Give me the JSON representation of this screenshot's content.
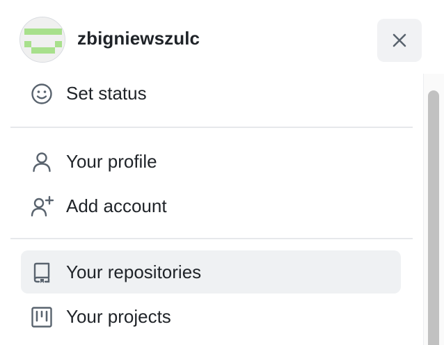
{
  "header": {
    "username": "zbigniewszulc",
    "avatar_icon": "identicon-avatar",
    "avatar_color": "#a8e08c",
    "close_icon": "close-icon"
  },
  "menu": {
    "items": [
      {
        "label": "Set status",
        "icon": "smiley-icon"
      },
      {
        "label": "Your profile",
        "icon": "person-icon"
      },
      {
        "label": "Add account",
        "icon": "person-add-icon"
      },
      {
        "label": "Your repositories",
        "icon": "repo-icon",
        "state": "hovered"
      },
      {
        "label": "Your projects",
        "icon": "project-icon"
      }
    ]
  }
}
